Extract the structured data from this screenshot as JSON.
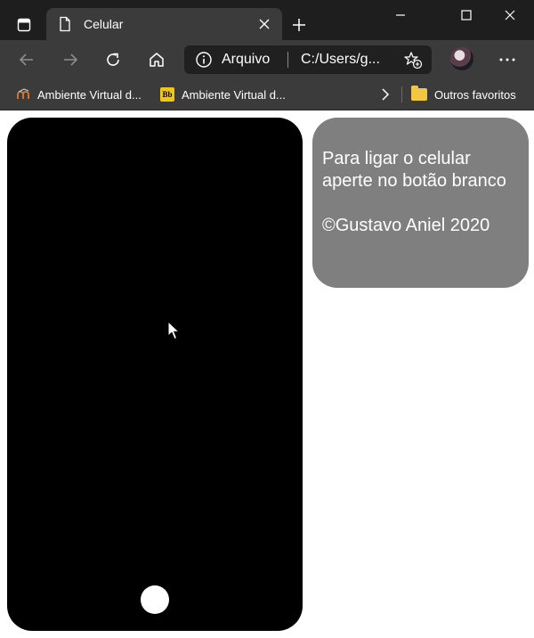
{
  "browser": {
    "tab": {
      "title": "Celular"
    },
    "address": {
      "scheme_label": "Arquivo",
      "url": "C:/Users/g..."
    },
    "favorites": [
      {
        "label": "Ambiente Virtual d..."
      },
      {
        "label": "Ambiente Virtual d..."
      }
    ],
    "favorites_badge": "Bb",
    "other_favorites": "Outros favoritos"
  },
  "page": {
    "info_text": "Para ligar o celular aperte no botão branco",
    "copyright": "©Gustavo Aniel 2020"
  },
  "icons": {
    "tab_actions": "tab-actions-icon",
    "favicon": "document-icon",
    "close": "close-icon",
    "new_tab": "plus-icon",
    "back": "arrow-left-icon",
    "forward": "arrow-right-icon",
    "reload": "reload-icon",
    "home": "home-icon",
    "info": "info-icon",
    "add_favorite": "star-plus-icon",
    "more": "ellipsis-icon",
    "chevron": "chevron-right-icon",
    "folder": "folder-icon"
  },
  "colors": {
    "titlebar": "#1e1e1e",
    "toolbar": "#3b3b3b",
    "phone": "#000000",
    "info_box": "#7f7f7f",
    "home_button": "#ffffff"
  }
}
